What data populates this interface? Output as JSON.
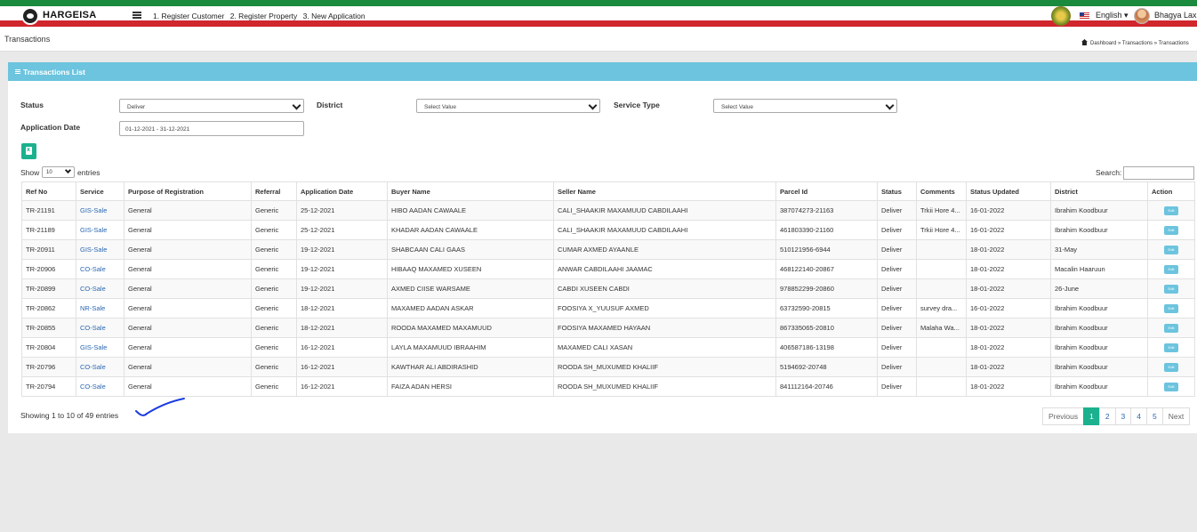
{
  "header": {
    "brand": "HARGEISA",
    "nav": [
      "1. Register Customer",
      "2. Register Property",
      "3. New Application"
    ],
    "language": "English ▾",
    "user": "Bhagya Laxm"
  },
  "page": {
    "title": "Transactions",
    "breadcrumb": "Dashboard  »  Transactions  »  Transactions"
  },
  "panel": {
    "title": "Transactions List"
  },
  "filters": {
    "status_label": "Status",
    "status_value": "Deliver",
    "district_label": "District",
    "district_value": "Select Value",
    "service_type_label": "Service Type",
    "service_type_value": "Select Value",
    "application_date_label": "Application Date",
    "application_date_value": "01-12-2021 - 31-12-2021"
  },
  "table_controls": {
    "show_label": "Show",
    "page_length": "10",
    "entries_label": "entries",
    "search_label": "Search:"
  },
  "table": {
    "columns": [
      "Ref No",
      "Service",
      "Purpose of Registration",
      "Referral",
      "Application Date",
      "Buyer Name",
      "Seller Name",
      "Parcel Id",
      "Status",
      "Comments",
      "Status Updated",
      "District",
      "Action"
    ],
    "action_label": "Edit",
    "rows": [
      [
        "TR-21191",
        "GIS-Sale",
        "General",
        "Generic",
        "25-12-2021",
        "HIBO AADAN CAWAALE",
        "CALI_SHAAKIR MAXAMUUD CABDILAAHI",
        "387074273-21163",
        "Deliver",
        "Trkii Hore 4...",
        "16-01-2022",
        "Ibrahim Koodbuur"
      ],
      [
        "TR-21189",
        "GIS-Sale",
        "General",
        "Generic",
        "25-12-2021",
        "KHADAR AADAN CAWAALE",
        "CALI_SHAAKIR MAXAMUUD CABDILAAHI",
        "461803390-21160",
        "Deliver",
        "Trkii Hore 4...",
        "16-01-2022",
        "Ibrahim Koodbuur"
      ],
      [
        "TR-20911",
        "GIS-Sale",
        "General",
        "Generic",
        "19-12-2021",
        "SHABCAAN CALI GAAS",
        "CUMAR AXMED AYAANLE",
        "510121956-6944",
        "Deliver",
        "",
        "18-01-2022",
        "31-May"
      ],
      [
        "TR-20906",
        "CO-Sale",
        "General",
        "Generic",
        "19-12-2021",
        "HIBAAQ MAXAMED XUSEEN",
        "ANWAR CABDILAAHI JAAMAC",
        "468122140-20867",
        "Deliver",
        "",
        "18-01-2022",
        "Macalin Haaruun"
      ],
      [
        "TR-20899",
        "CO-Sale",
        "General",
        "Generic",
        "19-12-2021",
        "AXMED CIISE WARSAME",
        "CABDI XUSEEN CABDI",
        "978852299-20860",
        "Deliver",
        "",
        "18-01-2022",
        "26-June"
      ],
      [
        "TR-20862",
        "NR-Sale",
        "General",
        "Generic",
        "18-12-2021",
        "MAXAMED AADAN ASKAR",
        "FOOSIYA X_YUUSUF AXMED",
        "63732590-20815",
        "Deliver",
        "survey dra...",
        "16-01-2022",
        "Ibrahim Koodbuur"
      ],
      [
        "TR-20855",
        "CO-Sale",
        "General",
        "Generic",
        "18-12-2021",
        "ROODA MAXAMED MAXAMUUD",
        "FOOSIYA MAXAMED HAYAAN",
        "867335065-20810",
        "Deliver",
        "Malaha Wa...",
        "18-01-2022",
        "Ibrahim Koodbuur"
      ],
      [
        "TR-20804",
        "GIS-Sale",
        "General",
        "Generic",
        "16-12-2021",
        "LAYLA MAXAMUUD IBRAAHIM",
        "MAXAMED CALI XASAN",
        "406587186-13198",
        "Deliver",
        "",
        "18-01-2022",
        "Ibrahim Koodbuur"
      ],
      [
        "TR-20796",
        "CO-Sale",
        "General",
        "Generic",
        "16-12-2021",
        "KAWTHAR ALI ABDIRASHID",
        "ROODA SH_MUXUMED KHALIIF",
        "5194692-20748",
        "Deliver",
        "",
        "18-01-2022",
        "Ibrahim Koodbuur"
      ],
      [
        "TR-20794",
        "CO-Sale",
        "General",
        "Generic",
        "16-12-2021",
        "FAIZA ADAN HERSI",
        "ROODA SH_MUXUMED KHALIIF",
        "841112164-20746",
        "Deliver",
        "",
        "18-01-2022",
        "Ibrahim Koodbuur"
      ]
    ]
  },
  "footer": {
    "info": "Showing 1 to 10 of 49 entries",
    "pagination": {
      "previous": "Previous",
      "pages": [
        "1",
        "2",
        "3",
        "4",
        "5"
      ],
      "active": "1",
      "next": "Next"
    }
  },
  "colors": {
    "accent": "#1bb18f",
    "panel_header": "#6cc4de",
    "link": "#2a67b1",
    "flag_green": "#1a8a3c",
    "flag_red": "#d0262c"
  }
}
